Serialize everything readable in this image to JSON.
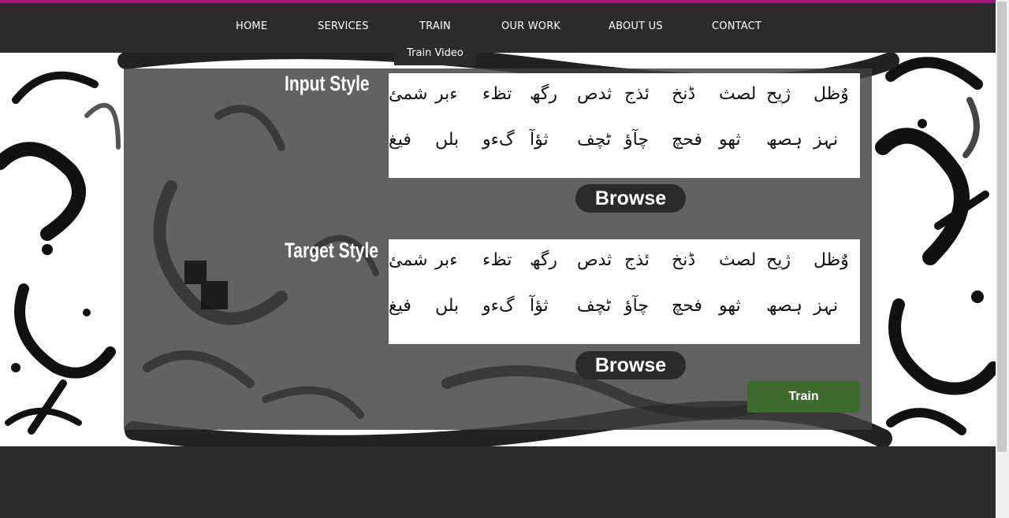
{
  "nav": {
    "items": [
      "HOME",
      "SERVICES",
      "TRAIN",
      "OUR WORK",
      "ABOUT US",
      "CONTACT"
    ],
    "dropdown_item": "Train Video"
  },
  "input_section": {
    "label": "Input Style",
    "browse_label": "Browse",
    "row1": [
      "وٌظل",
      "ژیح",
      "لصث",
      "ڈنخ",
      "ئذج",
      "ثدص",
      "رگھ",
      "تظء",
      "ءبر",
      "شمئ"
    ],
    "row2": [
      "نہز",
      "ہصھ",
      "ثھو",
      "فحچ",
      "چآؤ",
      "ٹچف",
      "ثؤآ",
      "گءو",
      "بلں",
      "فیغ"
    ]
  },
  "target_section": {
    "label": "Target Style",
    "browse_label": "Browse",
    "row1": [
      "وٌظل",
      "ژیح",
      "لصث",
      "ڈنخ",
      "ئذج",
      "ثدص",
      "رگھ",
      "تظء",
      "ءبر",
      "شمئ"
    ],
    "row2": [
      "نہز",
      "ہصھ",
      "ثھو",
      "فحچ",
      "چآؤ",
      "ٹچف",
      "ثؤآ",
      "گءو",
      "بلں",
      "فیغ"
    ]
  },
  "train_button": {
    "label": "Train"
  },
  "colors": {
    "accent": "#a0197a",
    "nav_bg": "#2b2b2b",
    "train_button": "#3e6b2e"
  }
}
